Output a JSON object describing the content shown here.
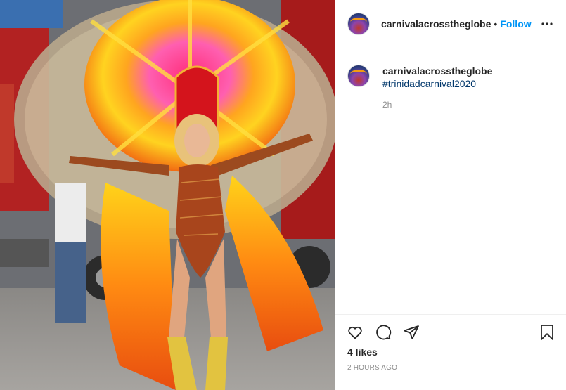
{
  "post": {
    "author": {
      "username": "carnivalacrosstheglobe",
      "avatar_icon": "profile-avatar-icon"
    },
    "header": {
      "separator": "•",
      "follow_label": "Follow",
      "more_icon": "more-options-icon"
    },
    "caption": {
      "username": "carnivalacrosstheglobe",
      "hashtag": "#trinidadcarnival2020",
      "relative_time": "2h"
    },
    "actions": {
      "like_icon": "heart-icon",
      "comment_icon": "comment-icon",
      "share_icon": "share-icon",
      "save_icon": "bookmark-icon"
    },
    "likes_text": "4 likes",
    "timestamp_text": "2 HOURS AGO",
    "colors": {
      "follow_blue": "#0095f6",
      "hashtag_blue": "#00376b",
      "muted_grey": "#8e8e8e",
      "divider": "#efefef"
    }
  }
}
